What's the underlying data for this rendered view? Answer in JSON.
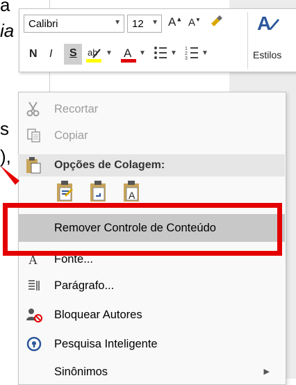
{
  "document": {
    "line1": "a",
    "line2": "ia",
    "line3": "s",
    "line4": "),"
  },
  "mini_toolbar": {
    "font_name": "Calibri",
    "font_size": "12",
    "styles_label": "Estilos",
    "bold_label": "N",
    "italic_label": "I",
    "underline_label": "S"
  },
  "context_menu": {
    "items": [
      {
        "label": "Recortar",
        "icon": "scissors-icon",
        "enabled": false
      },
      {
        "label": "Copiar",
        "icon": "copy-icon",
        "enabled": false
      },
      {
        "label": "Opções de Colagem:",
        "icon": "paste-icon",
        "type": "section"
      },
      {
        "label": "Remover Controle de Conteúdo",
        "highlighted": true
      },
      {
        "label": "Fonte...",
        "icon": "font-icon"
      },
      {
        "label": "Parágrafo...",
        "icon": "paragraph-icon"
      },
      {
        "label": "Bloquear Autores",
        "icon": "block-authors-icon"
      },
      {
        "label": "Pesquisa Inteligente",
        "icon": "smart-lookup-icon"
      },
      {
        "label": "Sinônimos",
        "icon": "",
        "submenu": true
      }
    ]
  },
  "colors": {
    "annotation_red": "#e50000",
    "highlight_gray": "#c8c8c8",
    "lookup_blue": "#2b579a"
  }
}
